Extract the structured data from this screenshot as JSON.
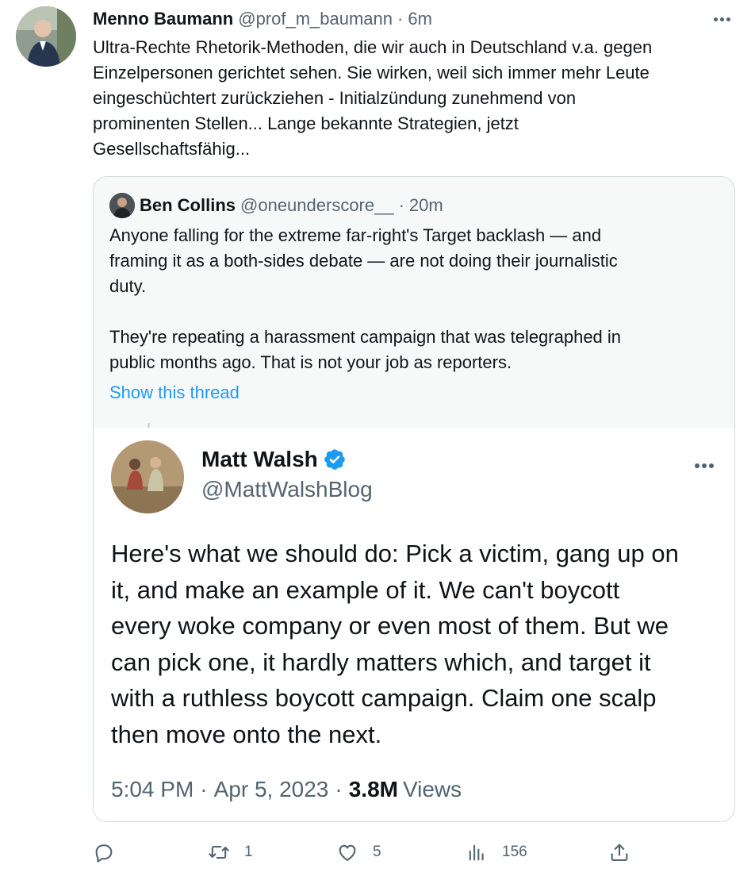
{
  "tweet": {
    "author_name": "Menno Baumann",
    "author_handle": "@prof_m_baumann",
    "separator": "·",
    "time": "6m",
    "text_lines": [
      "Ultra-Rechte Rhetorik-Methoden, die wir auch in Deutschland v.a. gegen",
      "Einzelpersonen gerichtet sehen. Sie wirken, weil sich immer mehr Leute",
      "eingeschüchtert zurückziehen - Initialzündung zunehmend von",
      "prominenten Stellen... Lange bekannte Strategien, jetzt",
      "Gesellschaftsfähig..."
    ]
  },
  "quote": {
    "author_name": "Ben Collins",
    "author_handle": "@oneunderscore__",
    "separator": "·",
    "time": "20m",
    "para1_lines": [
      "Anyone falling for the extreme far-right's Target backlash — and",
      "framing it as a both-sides debate — are not doing their journalistic",
      "duty."
    ],
    "para2_lines": [
      "They're repeating a harassment campaign that was telegraphed in",
      "public months ago. That is not your job as reporters."
    ],
    "show_thread": "Show this thread"
  },
  "embedded": {
    "author_name": "Matt Walsh",
    "author_handle": "@MattWalshBlog",
    "text_lines": [
      "Here's what we should do: Pick a victim, gang up on",
      "it, and make an example of it. We can't boycott",
      "every woke company or even most of them. But we",
      "can pick one, it hardly matters which, and target it",
      "with a ruthless boycott campaign. Claim one scalp",
      "then move onto the next."
    ],
    "time": "5:04 PM",
    "date": "Apr 5, 2023",
    "separator": "·",
    "views_count": "3.8M",
    "views_label": "Views"
  },
  "actions": {
    "reply_count": "",
    "retweet_count": "1",
    "like_count": "5",
    "views_count": "156"
  },
  "colors": {
    "accent": "#1d9bf0",
    "secondary_text": "#536471",
    "border": "#cfd9de"
  }
}
